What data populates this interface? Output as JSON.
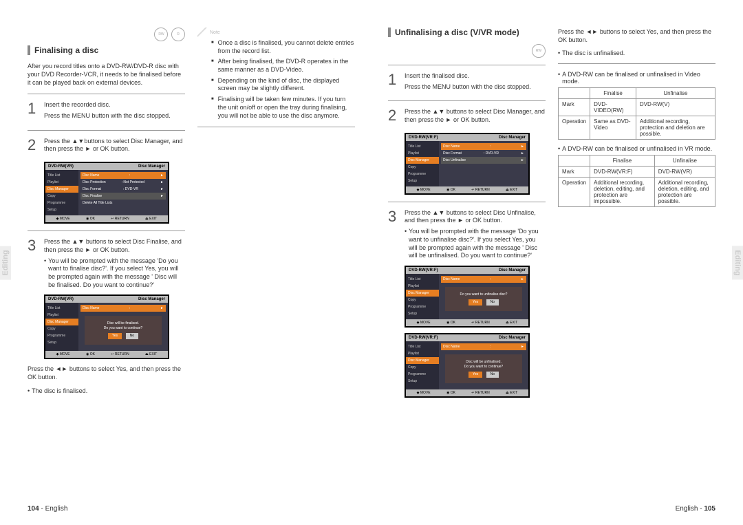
{
  "left": {
    "sideTab": "Editing",
    "pageNumber": "104",
    "pageLang": "English",
    "col1": {
      "title": "Finalising a disc",
      "intro": "After you record titles onto a DVD-RW/DVD-R disc with your DVD Recorder-VCR, it needs to be finalised before it can be played back on external devices.",
      "step1": {
        "num": "1",
        "line1": "Insert the recorded disc.",
        "line2": "Press the MENU button with the disc stopped."
      },
      "step2": {
        "num": "2",
        "text": "Press the ▲▼buttons to select Disc Manager, and  then press the ► or OK  button."
      },
      "osd1": {
        "title": "DVD-RW(VR)",
        "section": "Disc Manager",
        "menu": [
          "Title List",
          "Playlist",
          "Disc Manager",
          "Copy",
          "Programme",
          "Setup"
        ],
        "rows": [
          {
            "k": "Disc Name",
            "v": ":",
            "hi": true
          },
          {
            "k": "Disc Protection",
            "v": ": Not Protected"
          },
          {
            "k": "Disc Format",
            "v": ": DVD-VR"
          },
          {
            "k": "Disc Finalise",
            "v": "",
            "sel": true
          },
          {
            "k": "Delete All Title Lists",
            "v": ""
          }
        ],
        "footer": [
          "MOVE",
          "OK",
          "RETURN",
          "EXIT"
        ]
      },
      "step3": {
        "num": "3",
        "text": "Press the ▲▼ buttons to select Disc Finalise, and then press the ► or OK  button.",
        "bullet": "You will be prompted with the message 'Do you want to finalise disc?'. If you select Yes, you will be prompted again with the message ' Disc will be finalised. Do you want to continue?'"
      },
      "osd2": {
        "title": "DVD-RW(VR)",
        "section": "Disc Manager",
        "menu": [
          "Title List",
          "Playlist",
          "Disc Manager",
          "Copy",
          "Programme",
          "Setup"
        ],
        "topRow": {
          "k": "Disc Name",
          "v": ":",
          "hi": true
        },
        "dialog": "Disc will be finalised.\nDo you want to continue?",
        "buttons": [
          "Yes",
          "No"
        ],
        "footer": [
          "MOVE",
          "OK",
          "RETURN",
          "EXIT"
        ]
      },
      "afterOsd2a": "Press the ◄► buttons to select Yes, and then press the OK button.",
      "afterOsd2b": "The disc is finalised."
    },
    "col2": {
      "noteLabel": "Note",
      "notes": [
        "Once a disc is finalised, you cannot delete entries from the record list.",
        "After being finalised, the DVD-R operates in the same manner as a DVD-Video.",
        "Depending on the kind of disc, the displayed screen may be slightly different.",
        "Finalising will be taken few minutes. If you turn the unit on/off or open the tray during finalising, you will not be able to use the disc anymore."
      ]
    }
  },
  "right": {
    "sideTab": "Editing",
    "pageNumber": "105",
    "pageLang": "English",
    "col1": {
      "title": "Unfinalising a disc (V/VR mode)",
      "step1": {
        "num": "1",
        "line1": "Insert the finalised disc.",
        "line2": "Press the MENU button with the disc stopped."
      },
      "step2": {
        "num": "2",
        "text": "Press the ▲▼ buttons to select Disc Manager, and then press the ► or OK  button."
      },
      "osd1": {
        "title": "DVD-RW(VR:F)",
        "section": "Disc Manager",
        "menu": [
          "Title List",
          "Playlist",
          "Disc Manager",
          "Copy",
          "Programme",
          "Setup"
        ],
        "rows": [
          {
            "k": "Disc Name",
            "v": ":",
            "hi": true
          },
          {
            "k": "Disc Format",
            "v": ": DVD-VR"
          },
          {
            "k": "Disc Unfinalise",
            "v": "",
            "sel": true
          }
        ],
        "footer": [
          "MOVE",
          "OK",
          "RETURN",
          "EXIT"
        ]
      },
      "step3": {
        "num": "3",
        "text": "Press the ▲▼ buttons to select Disc Unfinalise, and then press the ► or OK  button.",
        "bullet": "You will be prompted with the message 'Do you want to unfinalise disc?'. If you select Yes, you will be prompted again with the message ' Disc will be unfinalised. Do you want to continue?'"
      },
      "osd2": {
        "title": "DVD-RW(VR:F)",
        "section": "Disc Manager",
        "topRow": {
          "k": "Disc Name",
          "v": ":",
          "hi": true
        },
        "dialog": "Do you want to unfinalise disc?",
        "buttons": [
          "Yes",
          "No"
        ],
        "footer": [
          "MOVE",
          "OK",
          "RETURN",
          "EXIT"
        ]
      },
      "osd3": {
        "title": "DVD-RW(VR:F)",
        "section": "Disc Manager",
        "topRow": {
          "k": "Disc Name",
          "v": ":",
          "hi": true
        },
        "dialog": "Disc will be unfinalised.\nDo you want to continue?",
        "buttons": [
          "Yes",
          "No"
        ],
        "footer": [
          "MOVE",
          "OK",
          "RETURN",
          "EXIT"
        ]
      }
    },
    "col2": {
      "topLine": "Press the ◄► buttons to select Yes, and then press the OK button.",
      "topBullet": "The disc is unfinalised.",
      "note1": "A DVD-RW can be finalised or unfinalised in Video mode.",
      "table1": {
        "headers": [
          "",
          "Finalise",
          "Unfinalise"
        ],
        "rows": [
          [
            "Mark",
            "DVD-VIDEO(RW)",
            "DVD-RW(V)"
          ],
          [
            "Operation",
            "Same as DVD-Video",
            "Additional recording, protection and deletion are possible."
          ]
        ]
      },
      "note2": "A DVD-RW can be finalised or unfinalised in VR mode.",
      "table2": {
        "headers": [
          "",
          "Finalise",
          "Unfinalise"
        ],
        "rows": [
          [
            "Mark",
            "DVD-RW(VR:F)",
            "DVD-RW(VR)"
          ],
          [
            "Operation",
            "Additional recording, deletion, editing, and protection are impossible.",
            "Additional recording, deletion, editing, and protection are possible."
          ]
        ]
      }
    }
  }
}
